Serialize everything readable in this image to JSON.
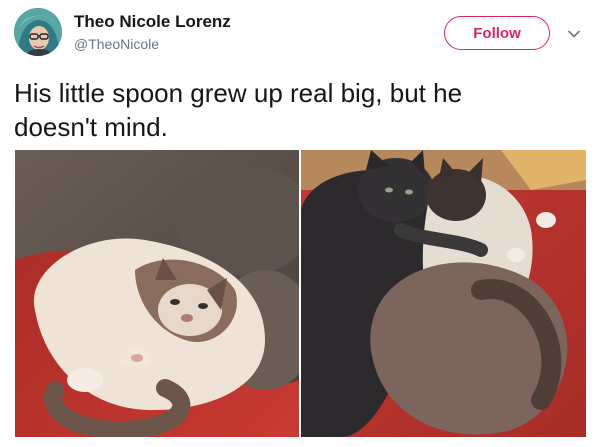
{
  "tweet": {
    "author": {
      "display_name": "Theo Nicole Lorenz",
      "handle": "@TheoNicole",
      "avatar_icon": "avatar-photo"
    },
    "follow_label": "Follow",
    "menu_icon": "chevron-down-icon",
    "text_line1": "His little spoon grew up real big, but he",
    "text_line2": "doesn't mind.",
    "media": [
      {
        "icon": "cat-photo-left",
        "description_visible": false
      },
      {
        "icon": "cat-photo-right",
        "description_visible": false
      }
    ]
  },
  "colors": {
    "accent": "#e0245e",
    "text": "#14171a",
    "secondary_text": "#657786",
    "blanket_red": "#c0302b"
  }
}
